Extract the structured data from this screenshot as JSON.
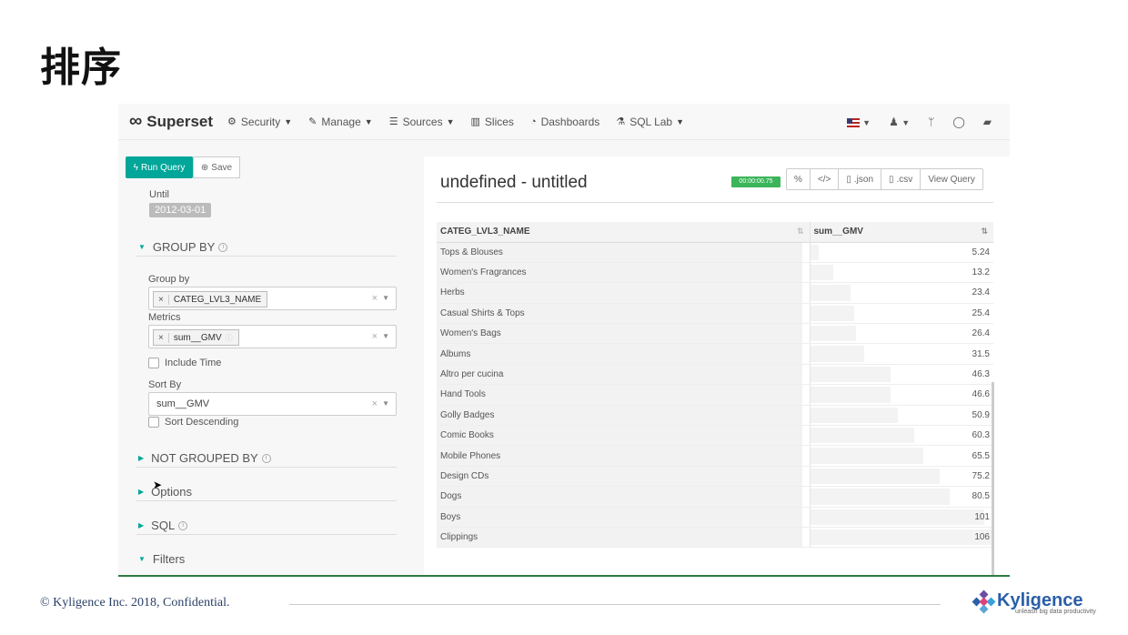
{
  "slide": {
    "title": "排序",
    "footer": "© Kyligence Inc. 2018, Confidential.",
    "logo": {
      "name": "Kyligence",
      "tagline": "unleash big data productivity"
    }
  },
  "navbar": {
    "brand": "Superset",
    "items": [
      {
        "label": "Security",
        "icon": "gear-icon",
        "glyph": "⚙"
      },
      {
        "label": "Manage",
        "icon": "wrench-icon",
        "glyph": "✎"
      },
      {
        "label": "Sources",
        "icon": "database-icon",
        "glyph": "☰"
      },
      {
        "label": "Slices",
        "icon": "bar-chart-icon",
        "glyph": "▥"
      },
      {
        "label": "Dashboards",
        "icon": "dashboard-icon",
        "glyph": "◔"
      },
      {
        "label": "SQL Lab",
        "icon": "flask-icon",
        "glyph": "⚗"
      }
    ]
  },
  "controls": {
    "run_query": "Run Query",
    "save": "Save",
    "until_label": "Until",
    "until_value": "2012-03-01",
    "group_by_section": "GROUP BY",
    "group_by_label": "Group by",
    "group_by_value": "CATEG_LVL3_NAME",
    "metrics_label": "Metrics",
    "metrics_value": "sum__GMV",
    "include_time": "Include Time",
    "sort_by_label": "Sort By",
    "sort_by_value": "sum__GMV",
    "sort_descending": "Sort Descending",
    "not_grouped_by": "NOT GROUPED BY",
    "options": "Options",
    "sql": "SQL",
    "filters": "Filters",
    "clear_symbol": "×"
  },
  "result": {
    "title": "undefined - untitled",
    "timer": "00:00:00.75",
    "actions": [
      "%",
      "</>",
      ".json",
      ".csv",
      "View Query"
    ],
    "columns": [
      "CATEG_LVL3_NAME",
      "sum__GMV"
    ],
    "rows": [
      {
        "name": "Tops & Blouses",
        "value": "5.24"
      },
      {
        "name": "Women's Fragrances",
        "value": "13.2"
      },
      {
        "name": "Herbs",
        "value": "23.4"
      },
      {
        "name": "Casual Shirts & Tops",
        "value": "25.4"
      },
      {
        "name": "Women's Bags",
        "value": "26.4"
      },
      {
        "name": "Albums",
        "value": "31.5"
      },
      {
        "name": "Altro per cucina",
        "value": "46.3"
      },
      {
        "name": "Hand Tools",
        "value": "46.6"
      },
      {
        "name": "Golly Badges",
        "value": "50.9"
      },
      {
        "name": "Comic Books",
        "value": "60.3"
      },
      {
        "name": "Mobile Phones",
        "value": "65.5"
      },
      {
        "name": "Design CDs",
        "value": "75.2"
      },
      {
        "name": "Dogs",
        "value": "80.5"
      },
      {
        "name": "Boys",
        "value": "101"
      },
      {
        "name": "Clippings",
        "value": "106"
      }
    ]
  },
  "colors": {
    "accent": "#00a699",
    "timer": "#3cb55a",
    "footer_text": "#2a3f66",
    "logo_blue": "#2a5fa8"
  }
}
